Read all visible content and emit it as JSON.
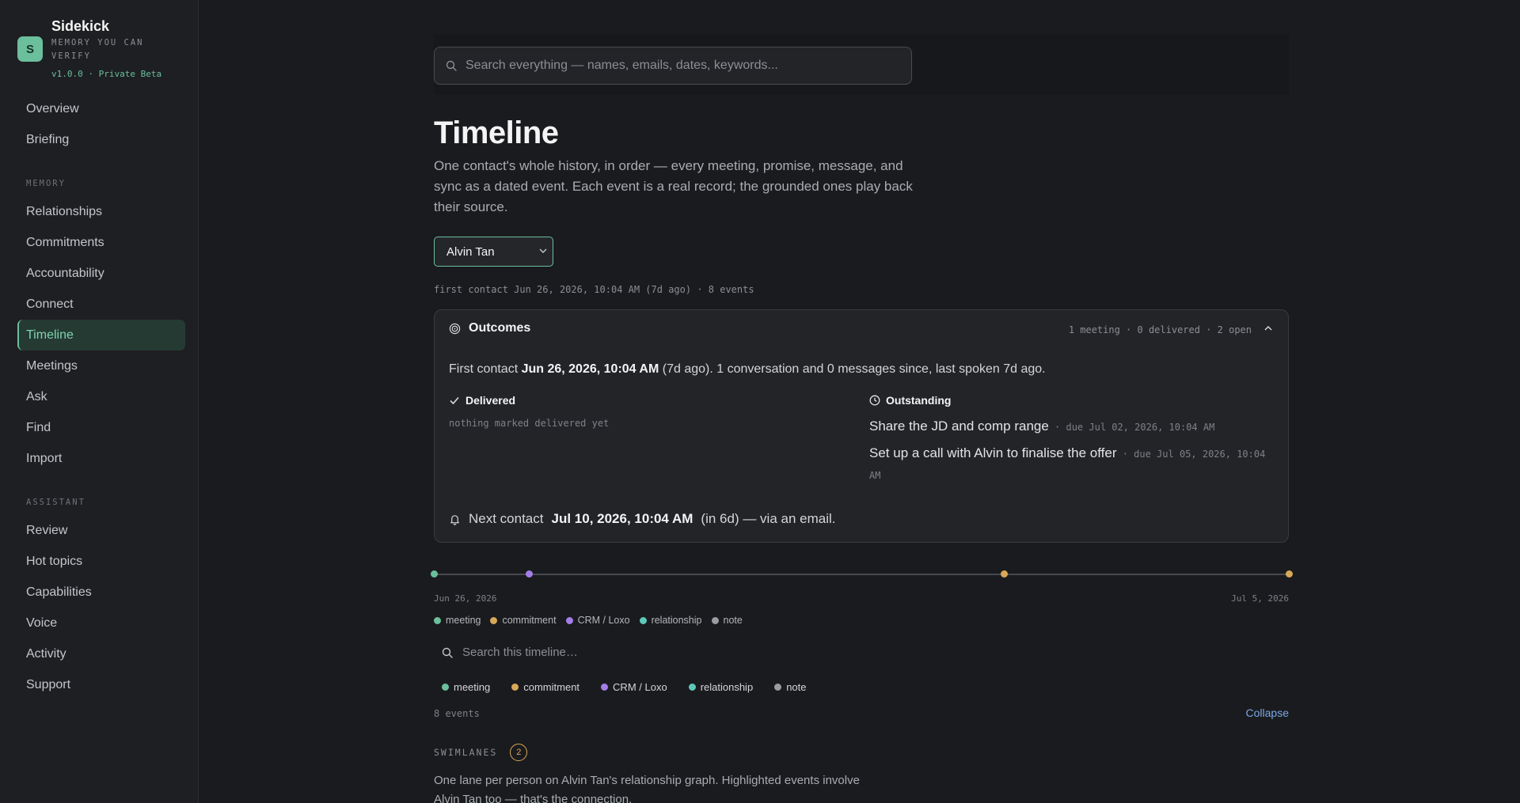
{
  "brand": {
    "logo_letter": "S",
    "name": "Sidekick",
    "tagline": "MEMORY YOU CAN VERIFY",
    "version": "v1.0.0 · Private Beta"
  },
  "sidebar": {
    "top_items": [
      "Overview",
      "Briefing"
    ],
    "memory_label": "MEMORY",
    "memory_items": [
      "Relationships",
      "Commitments",
      "Accountability",
      "Connect",
      "Timeline",
      "Meetings",
      "Ask",
      "Find",
      "Import"
    ],
    "assistant_label": "ASSISTANT",
    "assistant_items": [
      "Review",
      "Hot topics",
      "Capabilities",
      "Voice",
      "Activity",
      "Support"
    ],
    "active": "Timeline"
  },
  "search": {
    "placeholder": "Search everything — names, emails, dates, keywords..."
  },
  "page": {
    "title": "Timeline",
    "subtitle": "One contact's whole history, in order — every meeting, promise, message, and sync as a dated event. Each event is a real record; the grounded ones play back their source."
  },
  "contact_select": {
    "value": "Alvin Tan"
  },
  "meta_line": "first contact Jun 26, 2026, 10:04 AM (7d ago) · 8 events",
  "outcomes": {
    "title": "Outcomes",
    "stats": "1 meeting · 0 delivered · 2 open",
    "first_contact_prefix": "First contact ",
    "first_contact_date": "Jun 26, 2026, 10:04 AM",
    "first_contact_suffix": " (7d ago). 1 conversation and 0 messages since, last spoken 7d ago.",
    "delivered_label": "Delivered",
    "delivered_empty": "nothing marked delivered yet",
    "outstanding_label": "Outstanding",
    "outstanding": [
      {
        "text": "Share the JD and comp range",
        "due": " · due Jul 02, 2026, 10:04 AM"
      },
      {
        "text": "Set up a call with Alvin to finalise the offer",
        "due": " · due Jul 05, 2026, 10:04 AM"
      }
    ],
    "next_contact_prefix": "Next contact",
    "next_contact_date": "Jul 10, 2026, 10:04 AM",
    "next_contact_suffix": "(in 6d) — via an email."
  },
  "timeline": {
    "start_label": "Jun 26, 2026",
    "end_label": "Jul 5, 2026",
    "colors": {
      "meeting": "#6bbf9c",
      "commitment": "#d8a858",
      "crm": "#a37ee8",
      "relationship": "#5ec8b8",
      "note": "#9a9ca1"
    },
    "markers": [
      {
        "date": "2026-06-26",
        "kind": "meeting"
      },
      {
        "date": "2026-06-27",
        "kind": "crm"
      },
      {
        "date": "2026-07-02",
        "kind": "commitment"
      },
      {
        "date": "2026-07-05",
        "kind": "commitment"
      }
    ],
    "legend": [
      "meeting",
      "commitment",
      "CRM / Loxo",
      "relationship",
      "note"
    ],
    "search_placeholder": "Search this timeline…",
    "filters": [
      "meeting",
      "commitment",
      "CRM / Loxo",
      "relationship",
      "note"
    ],
    "count": "8 events",
    "collapse": "Collapse"
  },
  "swimlanes": {
    "label": "SWIMLANES",
    "badge": "2",
    "description": "One lane per person on Alvin Tan's relationship graph. Highlighted events involve Alvin Tan too — that's the connection."
  }
}
